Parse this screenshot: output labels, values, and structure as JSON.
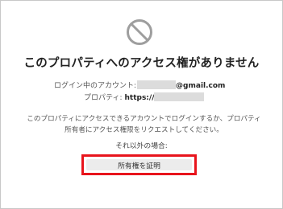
{
  "dialog": {
    "title": "このプロパティへのアクセス権がありません",
    "account_label": "ログイン中のアカウント:",
    "account_email_suffix": "@gmail.com",
    "property_label": "プロパティ:",
    "property_url_prefix": "https://",
    "description": "このプロパティにアクセスできるアカウントでログインするか、プロパティ所有者にアクセス権限をリクエストしてください。",
    "otherwise_label": "それ以外の場合:",
    "verify_button_label": "所有権を証明"
  },
  "icons": {
    "no_access": "prohibited-icon"
  },
  "colors": {
    "icon_gray": "#9e9e9e",
    "highlight_red": "#e8141c",
    "button_bg": "#ececec",
    "redaction_gray": "#dcdcdc"
  }
}
